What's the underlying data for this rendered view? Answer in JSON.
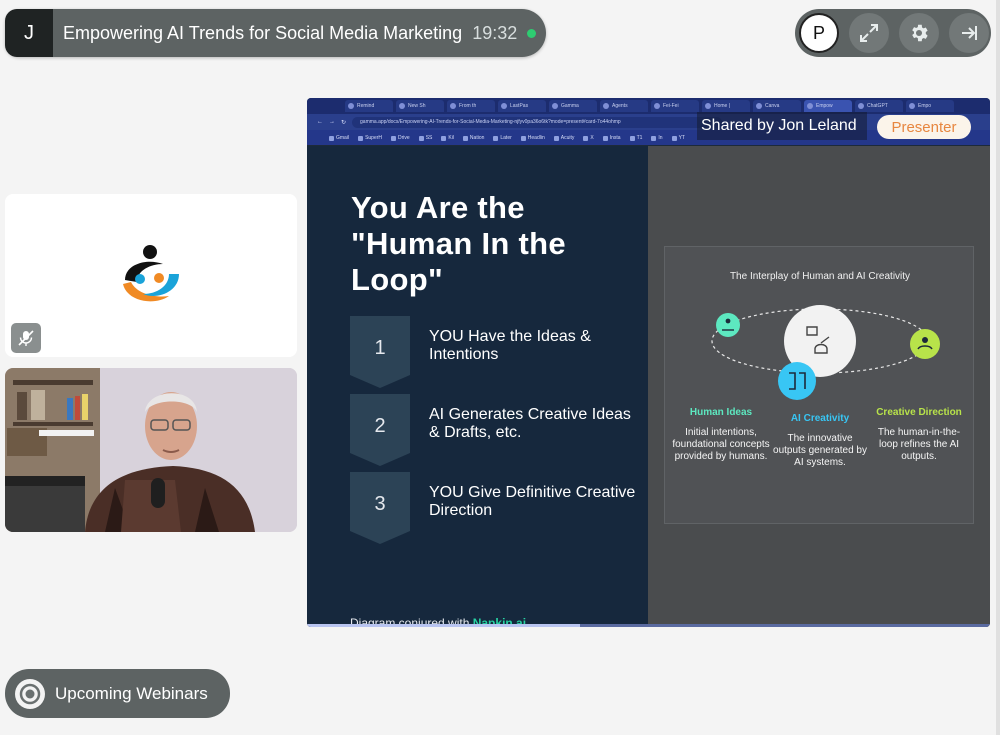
{
  "meeting": {
    "initial": "J",
    "title": "Empowering AI Trends for Social Media Marketing",
    "time": "19:32"
  },
  "controls": {
    "avatar_initial": "P"
  },
  "screen_share": {
    "shared_by": "Shared by Jon Leland",
    "presenter_badge": "Presenter",
    "browser": {
      "tabs": [
        "Remind",
        "New Sh",
        "From th",
        "LastPas",
        "Gamma",
        "Agents",
        "Fei-Fei",
        "Home |",
        "Canva",
        "Empow",
        "ChatGPT",
        "Empo"
      ],
      "url": "gamma.app/docs/Empowering-AI-Trends-for-Social-Media-Marketing-njfyv0pa36o6tk?mode=present#card-7o44ohmp",
      "bookmarks": [
        "Gmail",
        "SuperH",
        "Drive",
        "SS",
        "Kil",
        "Nation",
        "Later",
        "Headlin",
        "Acuity",
        "X",
        "Insta",
        "T1",
        "In",
        "YT"
      ]
    },
    "slide": {
      "title": "You Are the \"Human In the Loop\"",
      "steps": [
        {
          "number": "1",
          "text": "YOU Have the Ideas & Intentions"
        },
        {
          "number": "2",
          "text": "AI Generates Creative Ideas & Drafts, etc."
        },
        {
          "number": "3",
          "text": "YOU Give Definitive  Creative Direction"
        }
      ],
      "credit_prefix": "Diagram conjured with ",
      "credit_link": "Napkin.ai",
      "diagram": {
        "title": "The Interplay of Human and AI Creativity",
        "columns": [
          {
            "heading": "Human Ideas",
            "text": "Initial intentions, foundational concepts provided by humans."
          },
          {
            "heading": "AI Creativity",
            "text": "The innovative outputs generated by AI systems."
          },
          {
            "heading": "Creative Direction",
            "text": "The human-in-the-loop refines the AI outputs."
          }
        ]
      }
    }
  },
  "webinars": {
    "label": "Upcoming Webinars"
  },
  "colors": {
    "live": "#2ecc71",
    "presenter_text": "#e7863f",
    "accent_green": "#27d1a3",
    "human_ideas": "#5de8c0",
    "ai_creativity": "#38c6f4",
    "creative_direction": "#b8e34a"
  }
}
